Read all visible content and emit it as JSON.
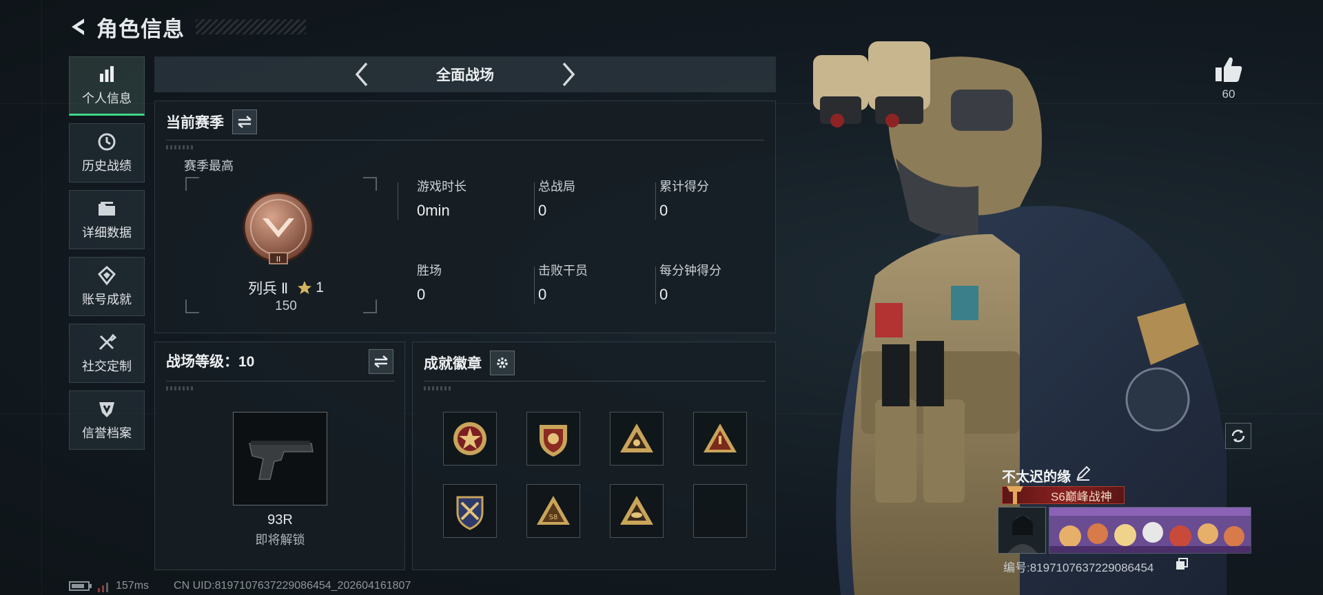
{
  "header": {
    "title": "角色信息"
  },
  "nav": {
    "items": [
      {
        "label": "个人信息",
        "icon": "bar-chart-icon",
        "active": true
      },
      {
        "label": "历史战绩",
        "icon": "clock-icon"
      },
      {
        "label": "详细数据",
        "icon": "folder-icon"
      },
      {
        "label": "账号成就",
        "icon": "diamond-badge-icon"
      },
      {
        "label": "社交定制",
        "icon": "tools-icon"
      },
      {
        "label": "信誉档案",
        "icon": "shield-check-icon"
      }
    ]
  },
  "mode": {
    "title": "全面战场"
  },
  "season": {
    "title": "当前赛季",
    "best_label": "赛季最高",
    "rank_name": "列兵 Ⅱ",
    "rank_stars": "1",
    "rank_points": "150",
    "stats": [
      {
        "label": "游戏时长",
        "value": "0min"
      },
      {
        "label": "总战局",
        "value": "0"
      },
      {
        "label": "累计得分",
        "value": "0"
      },
      {
        "label": "胜场",
        "value": "0"
      },
      {
        "label": "击败干员",
        "value": "0"
      },
      {
        "label": "每分钟得分",
        "value": "0"
      }
    ]
  },
  "battlefield": {
    "title": "战场等级：10",
    "weapon_name": "93R",
    "weapon_status": "即将解锁"
  },
  "achievements": {
    "title": "成就徽章",
    "badges": [
      "star-medal-icon",
      "shield-crest-icon",
      "triangle-emblem-icon",
      "triangle-warning-icon",
      "knife-shield-icon",
      "triangle-s8-icon",
      "triangle-eye-icon",
      "empty-slot"
    ]
  },
  "profile": {
    "likes": "60",
    "player_name": "不太迟的缘",
    "title_plate": "S6巅峰战神",
    "player_id": "编号:8197107637229086454"
  },
  "footer": {
    "ping": "157ms",
    "uid": "CN UID:8197107637229086454_202604161807"
  },
  "colors": {
    "accent_green": "#3fd88a",
    "plate_red": "#8a1f1f",
    "gold": "#c9a45a"
  }
}
